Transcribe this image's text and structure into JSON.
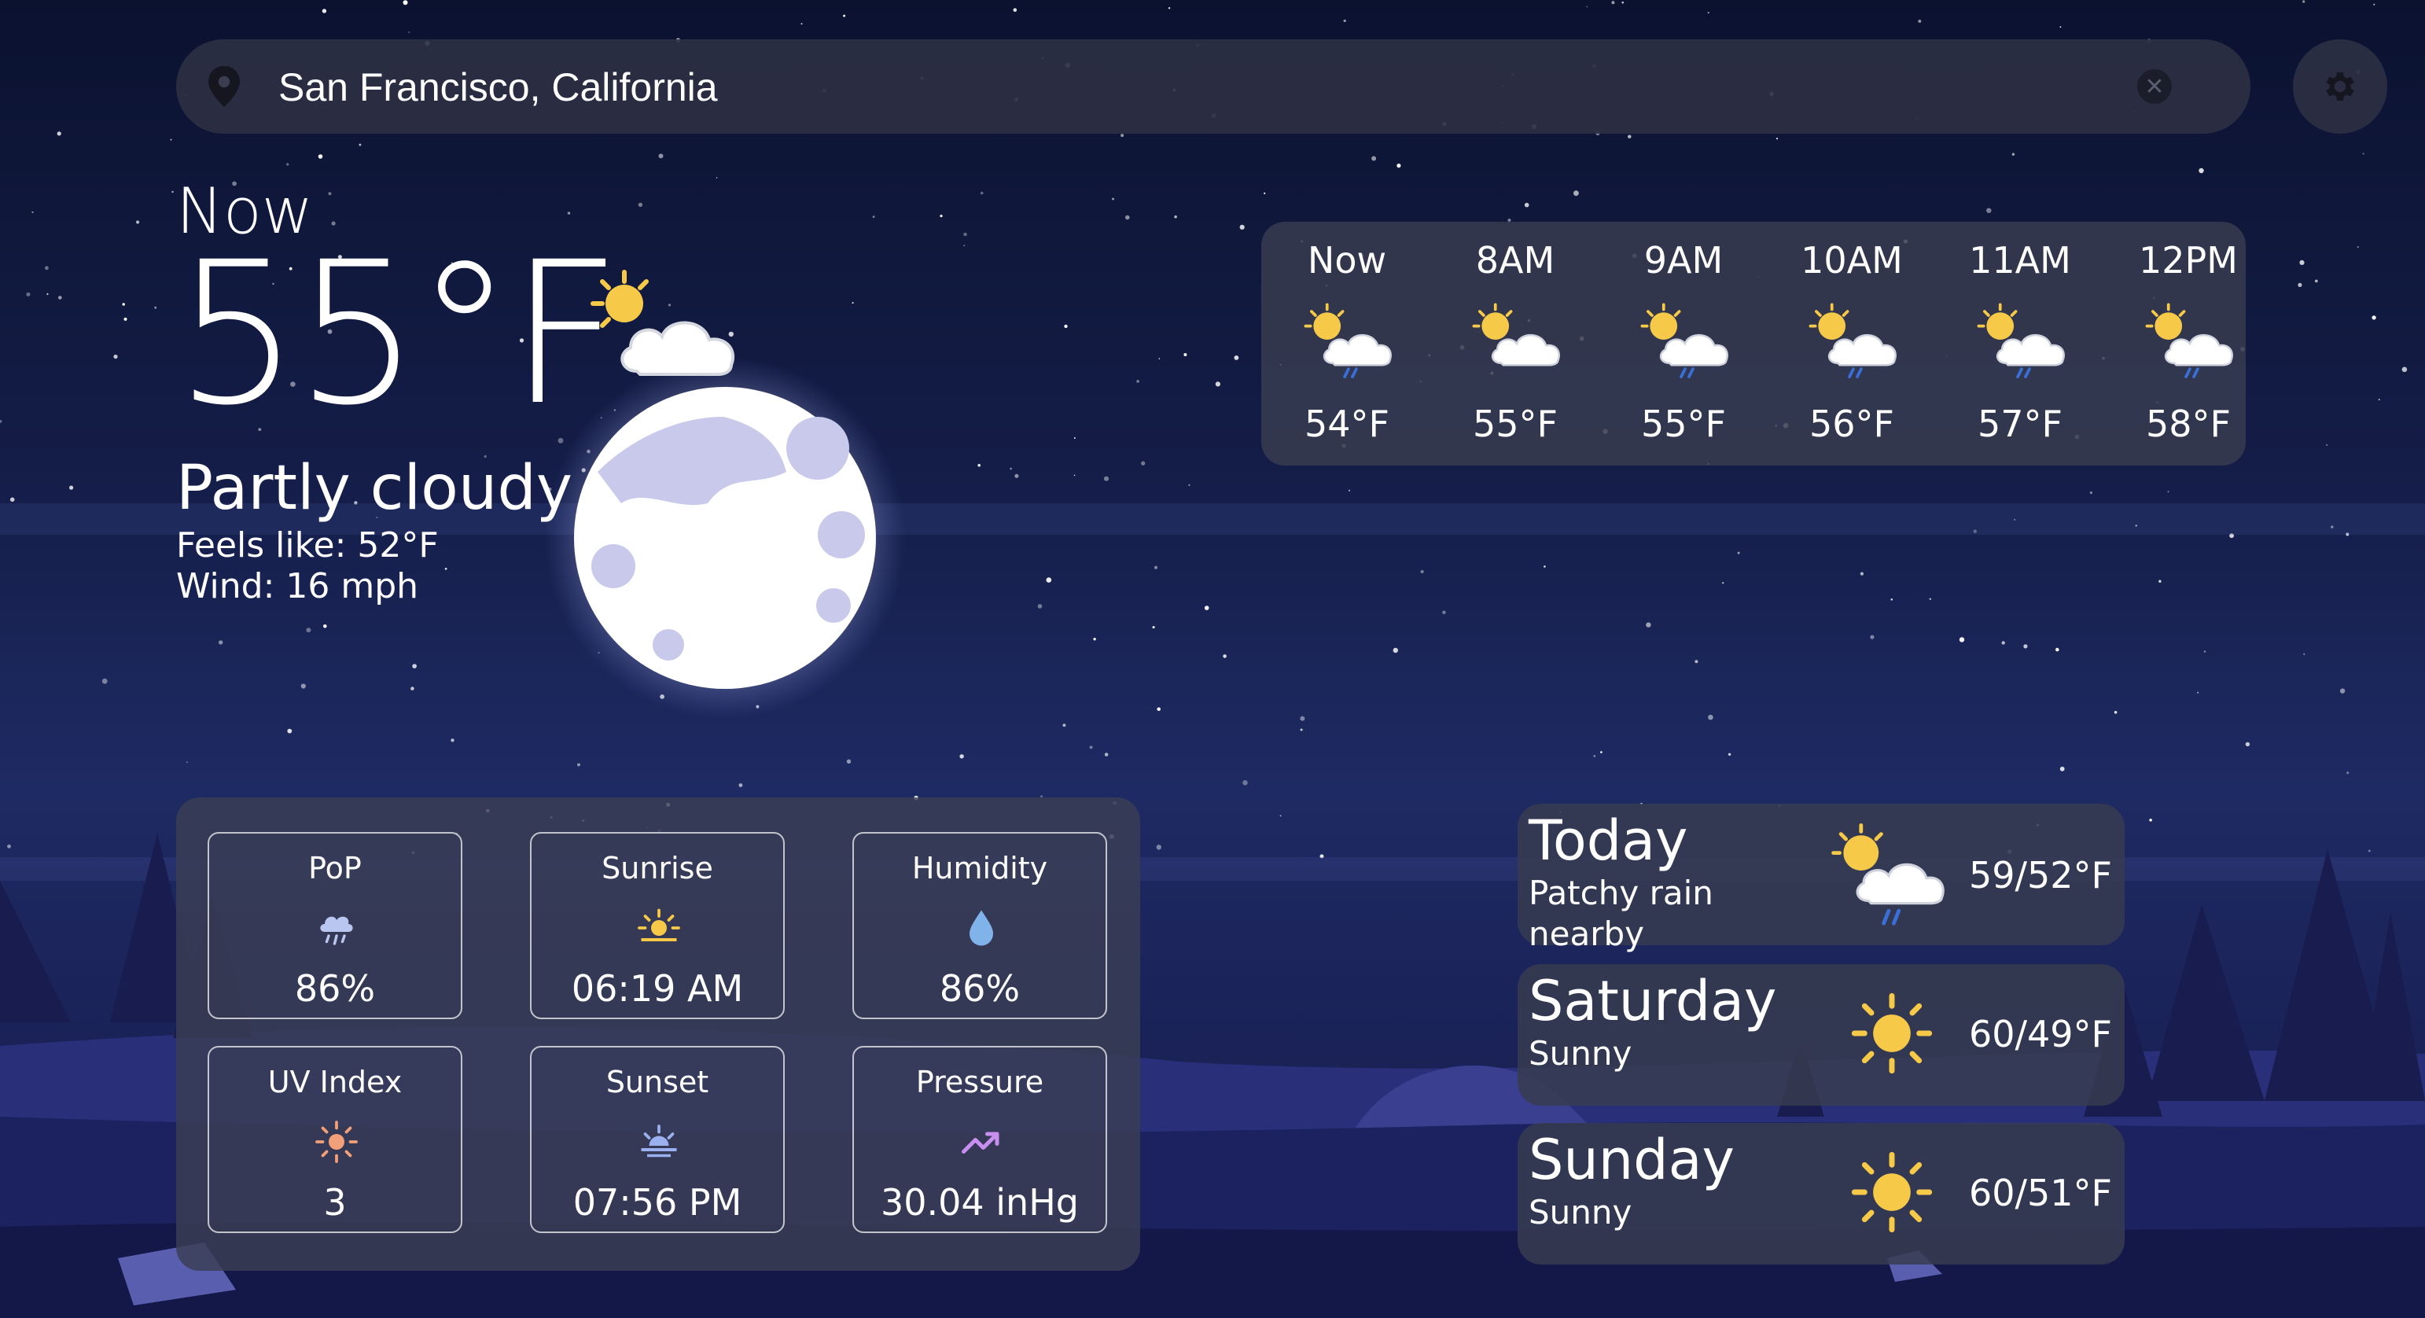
{
  "search": {
    "value": "San Francisco, California",
    "clear_icon": "close-circle-icon",
    "location_icon": "location-pin-icon"
  },
  "settings": {
    "icon": "gear-icon"
  },
  "current": {
    "label": "Now",
    "temperature": "55°F",
    "condition": "Partly cloudy",
    "feels_like": "Feels like: 52°F",
    "wind": "Wind: 16 mph",
    "icon": "partly-cloudy-icon"
  },
  "hourly": [
    {
      "time": "Now",
      "temp": "54°F",
      "icon": "partly-cloudy-rain-icon"
    },
    {
      "time": "8AM",
      "temp": "55°F",
      "icon": "partly-cloudy-icon"
    },
    {
      "time": "9AM",
      "temp": "55°F",
      "icon": "partly-cloudy-rain-icon"
    },
    {
      "time": "10AM",
      "temp": "56°F",
      "icon": "partly-cloudy-rain-icon"
    },
    {
      "time": "11AM",
      "temp": "57°F",
      "icon": "partly-cloudy-rain-icon"
    },
    {
      "time": "12PM",
      "temp": "58°F",
      "icon": "partly-cloudy-rain-icon"
    }
  ],
  "details": [
    {
      "label": "PoP",
      "value": "86%",
      "icon": "rain-cloud-icon"
    },
    {
      "label": "Sunrise",
      "value": "06:19 AM",
      "icon": "sunrise-icon"
    },
    {
      "label": "Humidity",
      "value": "86%",
      "icon": "water-drop-icon"
    },
    {
      "label": "UV Index",
      "value": "3",
      "icon": "sun-icon"
    },
    {
      "label": "Sunset",
      "value": "07:56 PM",
      "icon": "sunset-icon"
    },
    {
      "label": "Pressure",
      "value": "30.04 inHg",
      "icon": "trending-up-icon"
    }
  ],
  "daily": [
    {
      "day": "Today",
      "condition": "Patchy rain nearby",
      "temp": "59/52°F",
      "icon": "partly-cloudy-rain-icon"
    },
    {
      "day": "Saturday",
      "condition": "Sunny",
      "temp": "60/49°F",
      "icon": "sun-icon"
    },
    {
      "day": "Sunday",
      "condition": "Sunny",
      "temp": "60/51°F",
      "icon": "sun-icon"
    }
  ],
  "colors": {
    "accent": "#3b6fd8",
    "sun": "#f7c948",
    "panel": "#373c50"
  }
}
